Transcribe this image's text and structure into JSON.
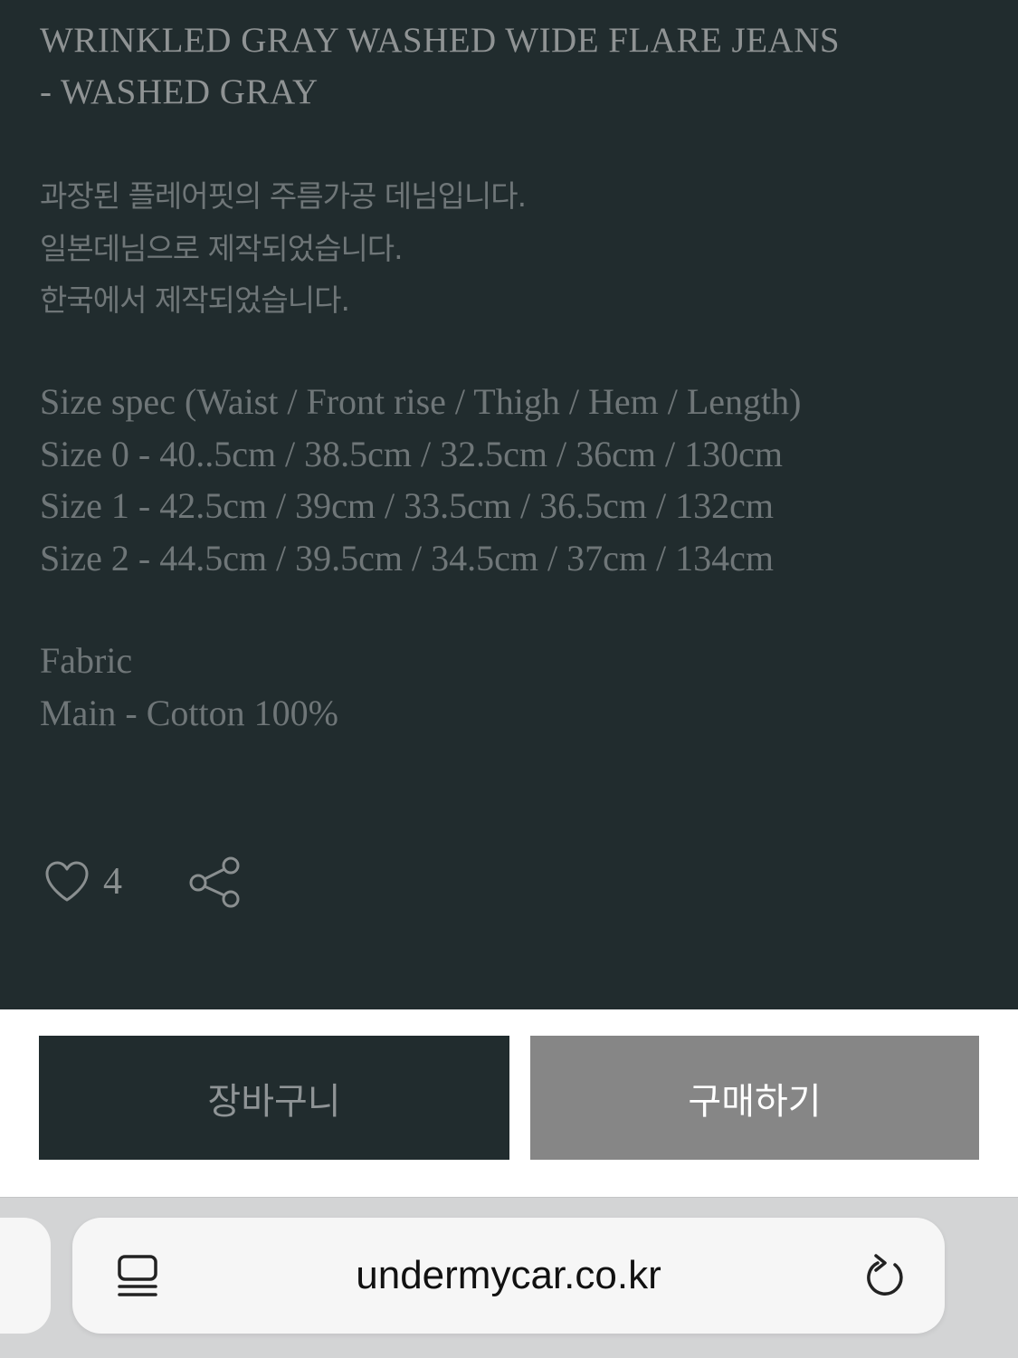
{
  "product": {
    "title_lines": [
      "WRINKLED GRAY WASHED WIDE FLARE JEANS",
      "- WASHED GRAY"
    ],
    "description_lines": [
      "과장된 플레어핏의 주름가공 데님입니다.",
      "일본데님으로 제작되었습니다.",
      "한국에서 제작되었습니다."
    ],
    "size_spec_lines": [
      "Size spec (Waist / Front rise / Thigh / Hem / Length)",
      "Size 0 - 40..5cm / 38.5cm / 32.5cm / 36cm / 130cm",
      "Size 1 - 42.5cm / 39cm / 33.5cm / 36.5cm / 132cm",
      "Size 2 - 44.5cm / 39.5cm / 34.5cm / 37cm / 134cm"
    ],
    "fabric_lines": [
      "Fabric",
      "Main - Cotton 100%"
    ]
  },
  "actions": {
    "like_count": "4",
    "like_icon": "heart-outline-icon",
    "share_icon": "share-icon"
  },
  "buttons": {
    "cart_label": "장바구니",
    "buy_label": "구매하기"
  },
  "browser": {
    "url": "undermycar.co.kr",
    "reader_icon": "reader-mode-icon",
    "reload_icon": "reload-icon"
  },
  "colors": {
    "content_background": "#212c2e",
    "text_muted": "#6f7678",
    "cart_button": "#212c2e",
    "buy_button": "#868686",
    "browser_toolbar": "#d3d4d5"
  }
}
